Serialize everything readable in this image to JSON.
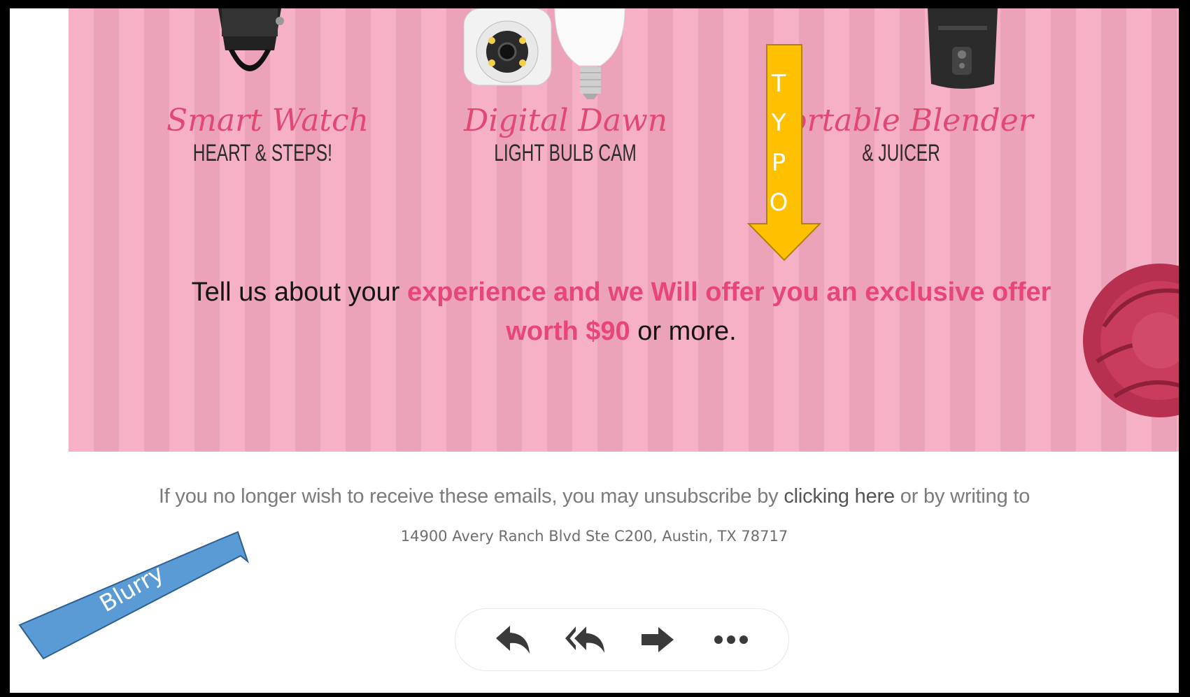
{
  "products": [
    {
      "name": "Smart Watch",
      "caption": "HEART & STEPS!"
    },
    {
      "name": "Digital Dawn",
      "caption": "LIGHT BULB CAM"
    },
    {
      "name": "Portable Blender",
      "caption": "& JUICER"
    }
  ],
  "promo": {
    "lead": "Tell us about your ",
    "highlight": "experience and we Will offer you an exclusive offer worth $90",
    "tail": " or more."
  },
  "footer": {
    "unsubscribe_prefix": "If you no longer wish to receive these emails, you may unsubscribe by ",
    "unsubscribe_link": "clicking here",
    "unsubscribe_suffix": " or by writing to",
    "address": "14900 Avery Ranch Blvd Ste C200, Austin, TX 78717"
  },
  "actions": [
    {
      "icon": "reply-icon"
    },
    {
      "icon": "reply-all-icon"
    },
    {
      "icon": "forward-icon"
    },
    {
      "icon": "more-icon"
    }
  ],
  "annotations": {
    "typo": {
      "letters": [
        "T",
        "Y",
        "P",
        "O"
      ],
      "color": "#ffc000"
    },
    "blurry": {
      "label": "Blurry",
      "color": "#5b9bd5"
    }
  },
  "colors": {
    "accent_pink": "#e8467a",
    "banner_pink": "#f5a8bf"
  }
}
